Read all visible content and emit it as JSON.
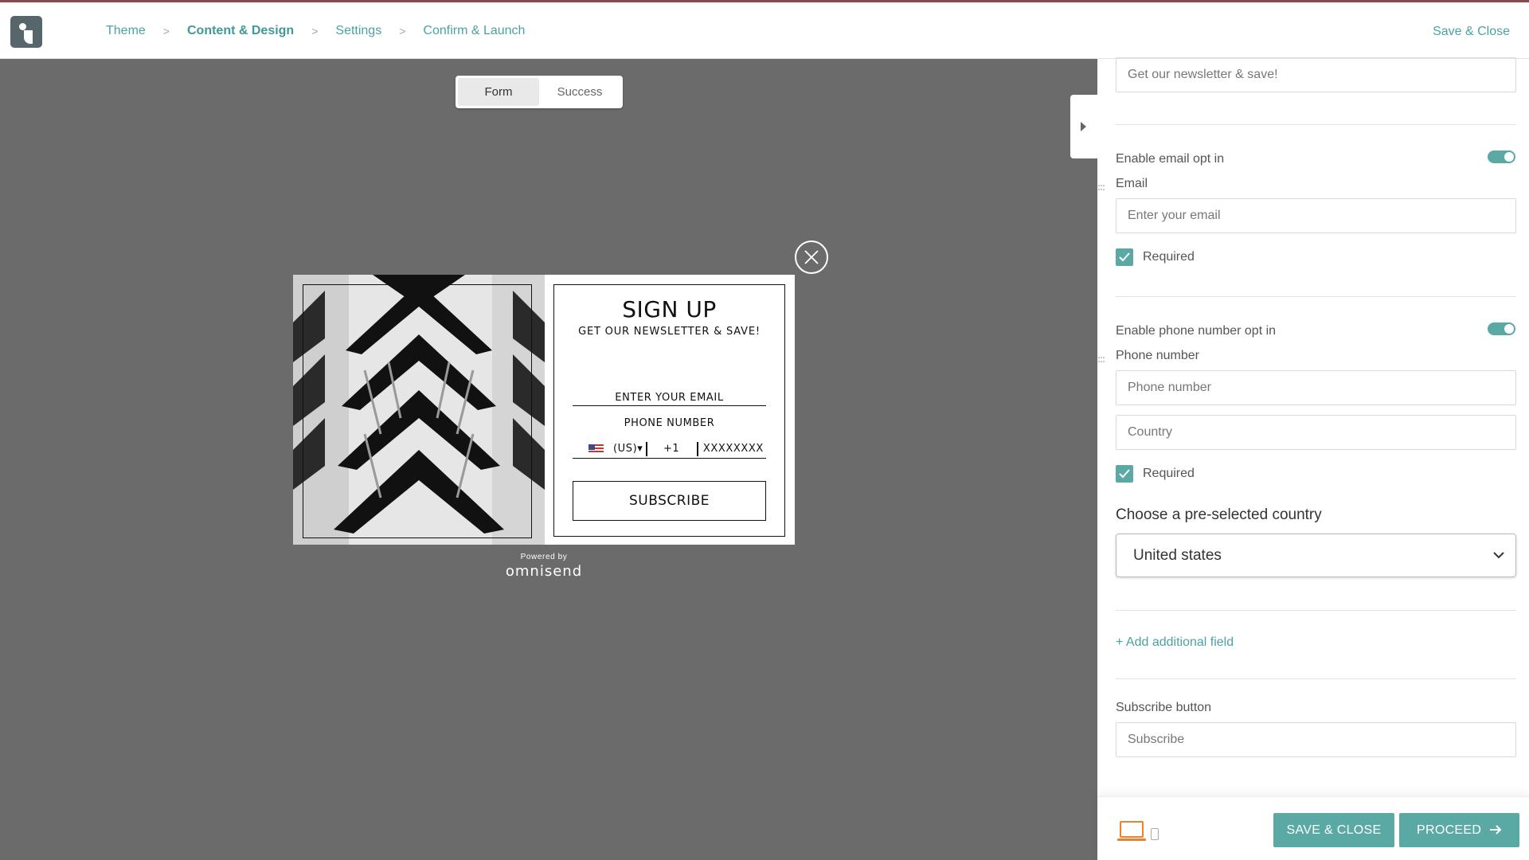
{
  "nav": {
    "logo_icon": "omnisend-logo-icon",
    "steps": [
      "Theme",
      "Content & Design",
      "Settings",
      "Confirm & Launch"
    ],
    "active_step": "Content & Design",
    "save_close": "Save & Close"
  },
  "preview": {
    "tabs": [
      "Form",
      "Success"
    ],
    "active_tab": "Form"
  },
  "popup": {
    "title": "SIGN UP",
    "subtitle": "GET OUR NEWSLETTER & SAVE!",
    "email_placeholder": "ENTER YOUR EMAIL",
    "phone_label": "PHONE NUMBER",
    "country_code": "(US)▾",
    "dial_code": "+1",
    "phone_placeholder": "XXXXXXXX",
    "button": "SUBSCRIBE",
    "powered_by": "Powered by",
    "brand": "omnisend"
  },
  "panel": {
    "subtitle_value": "Get our newsletter & save!",
    "email_toggle_label": "Enable email opt in",
    "email_label": "Email",
    "email_placeholder": "Enter your email",
    "email_required": "Required",
    "phone_toggle_label": "Enable phone number opt in",
    "phone_label": "Phone number",
    "phone_placeholder": "Phone number",
    "country_placeholder": "Country",
    "phone_required": "Required",
    "country_heading": "Choose a pre-selected country",
    "country_selected": "United states",
    "add_field": "+ Add additional field",
    "subscribe_label": "Subscribe button",
    "subscribe_value": "Subscribe"
  },
  "footer": {
    "save_close": "SAVE & CLOSE",
    "proceed": "PROCEED",
    "accent": "#5aa9a5"
  }
}
